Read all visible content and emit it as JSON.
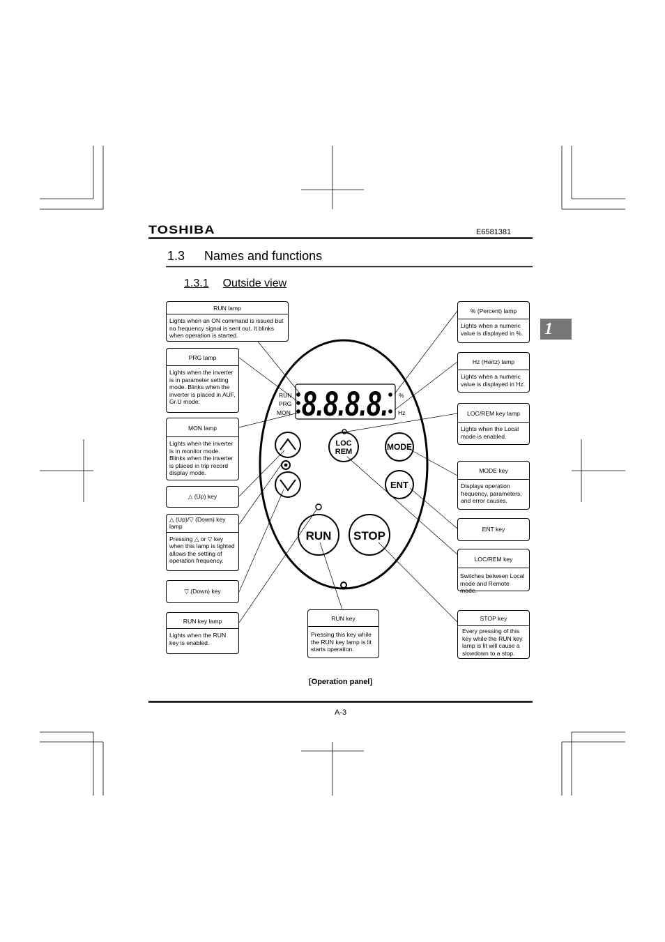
{
  "header": {
    "brand": "TOSHIBA",
    "doc_number": "E6581381"
  },
  "section": {
    "number": "1.3",
    "title": "Names and functions"
  },
  "subsection": {
    "number": "1.3.1",
    "title": "Outside view"
  },
  "chapter_tab": "1",
  "panel": {
    "display_digits": "8.8.8.8.",
    "lamp_labels": {
      "run": "RUN",
      "prg": "PRG",
      "mon": "MON",
      "percent": "%",
      "hz": "Hz"
    },
    "keys": {
      "loc": "LOC",
      "rem": "REM",
      "mode": "MODE",
      "ent": "ENT",
      "run": "RUN",
      "stop": "STOP"
    }
  },
  "callouts": {
    "run_lamp": {
      "title": "RUN lamp",
      "desc": "Lights when an ON command is issued but no frequency signal is sent out. It blinks when operation is started."
    },
    "prg_lamp": {
      "title": "PRG lamp",
      "desc": "Lights when the inverter is in parameter setting mode. Blinks when the inverter is placed in AUF, Gr.U mode."
    },
    "mon_lamp": {
      "title": "MON lamp",
      "desc": "Lights when the inverter is in monitor mode. Blinks when the inverter is placed in trip record display mode."
    },
    "up_key": {
      "title": "△ (Up) key"
    },
    "updown_lamp": {
      "title": "△ (Up)/▽ (Down) key lamp",
      "desc": "Pressing △ or ▽ key when this lamp is lighted allows the setting of operation frequency."
    },
    "down_key": {
      "title": "▽ (Down) key"
    },
    "run_key_lamp": {
      "title": "RUN key lamp",
      "desc": "Lights when the RUN key is enabled."
    },
    "run_key": {
      "title": "RUN key",
      "desc": "Pressing this key while the RUN key lamp is lit starts operation."
    },
    "percent_lamp": {
      "title": "% (Percent) lamp",
      "desc": "Lights when a numeric value is displayed in %."
    },
    "hz_lamp": {
      "title": "Hz (Hertz) lamp",
      "desc": "Lights when a numeric value is displayed in Hz."
    },
    "locrem_lamp": {
      "title": "LOC/REM key lamp",
      "desc": "Lights when the Local mode is enabled."
    },
    "mode_key": {
      "title": "MODE key",
      "desc": "Displays operation frequency, parameters, and error causes."
    },
    "ent_key": {
      "title": "ENT key"
    },
    "locrem_key": {
      "title": "LOC/REM key",
      "desc": "Switches between Local mode and Remote mode."
    },
    "stop_key": {
      "title": "STOP key",
      "desc": "Every pressing of this key while the RUN key lamp is lit will cause a slowdown to a stop."
    }
  },
  "caption": "[Operation panel]",
  "footer": {
    "page": "A-3"
  }
}
